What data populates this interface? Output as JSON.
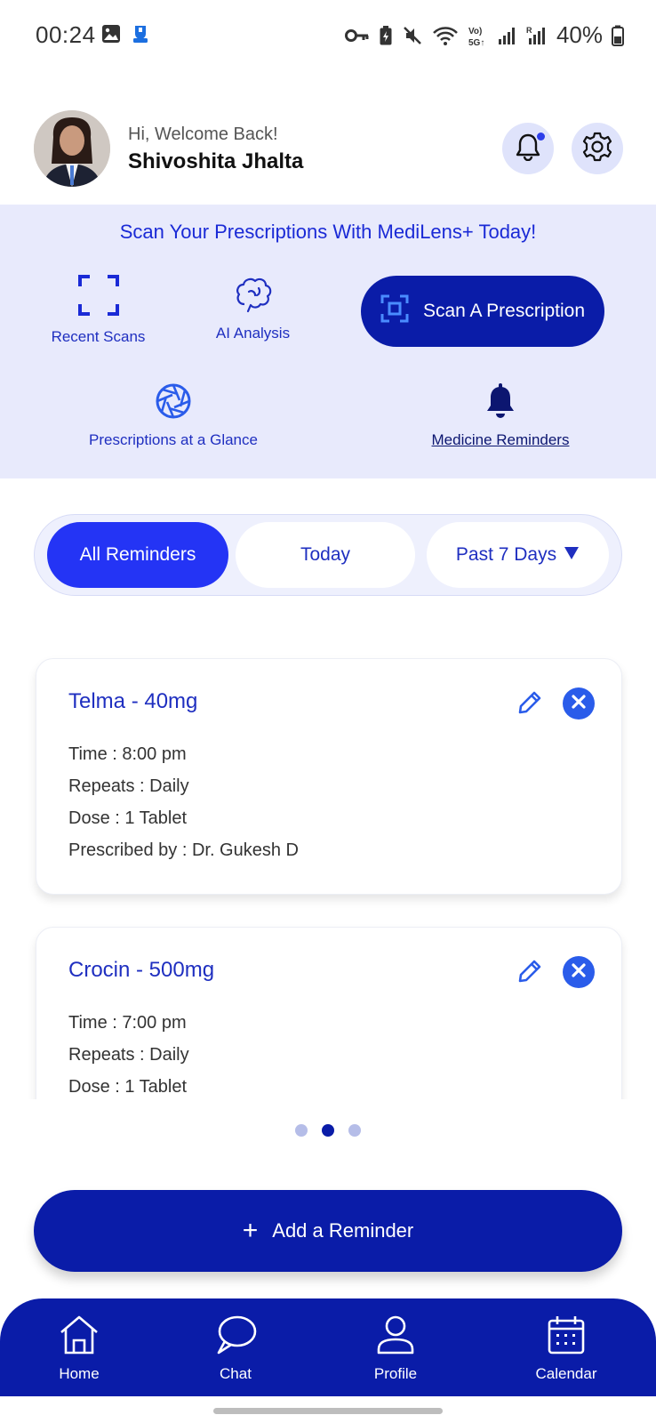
{
  "status_bar": {
    "time": "00:24",
    "battery": "40%",
    "icons": [
      "image-icon",
      "app-notification-icon",
      "key-icon",
      "battery-saver-icon",
      "mute-icon",
      "wifi-icon",
      "volte-icon",
      "signal-icon",
      "signal-roaming-icon",
      "battery-icon"
    ]
  },
  "header": {
    "greeting": "Hi, Welcome Back!",
    "user_name": "Shivoshita Jhalta",
    "notification_icon": "bell-icon",
    "settings_icon": "gear-icon"
  },
  "banner": {
    "title": "Scan Your Prescriptions With MediLens+ Today!",
    "features": {
      "recent_scans": "Recent Scans",
      "ai_analysis": "AI Analysis",
      "glance": "Prescriptions at a Glance",
      "reminders": "Medicine Reminders"
    },
    "scan_button": "Scan A Prescription"
  },
  "filters": {
    "items": [
      "All Reminders",
      "Today",
      "Past 7 Days"
    ],
    "active": "All Reminders",
    "dropdown_icon": "caret-down-icon"
  },
  "reminders": [
    {
      "title": "Telma - 40mg",
      "time": "Time : 8:00 pm",
      "repeats": "Repeats : Daily",
      "dose": "Dose : 1 Tablet",
      "prescribed_by": "Prescribed by : Dr. Gukesh D"
    },
    {
      "title": "Crocin - 500mg",
      "time": "Time : 7:00 pm",
      "repeats": "Repeats : Daily",
      "dose": "Dose : 1 Tablet"
    }
  ],
  "pagination": {
    "count": 3,
    "active_index": 1
  },
  "add_button": {
    "plus": "+",
    "label": "Add a Reminder"
  },
  "bottom_nav": {
    "home": "Home",
    "chat": "Chat",
    "profile": "Profile",
    "calendar": "Calendar"
  },
  "colors": {
    "primary": "#0a1ca8",
    "accent": "#2434f5",
    "banner_bg": "#e8eafc",
    "link": "#1f2fc0"
  }
}
